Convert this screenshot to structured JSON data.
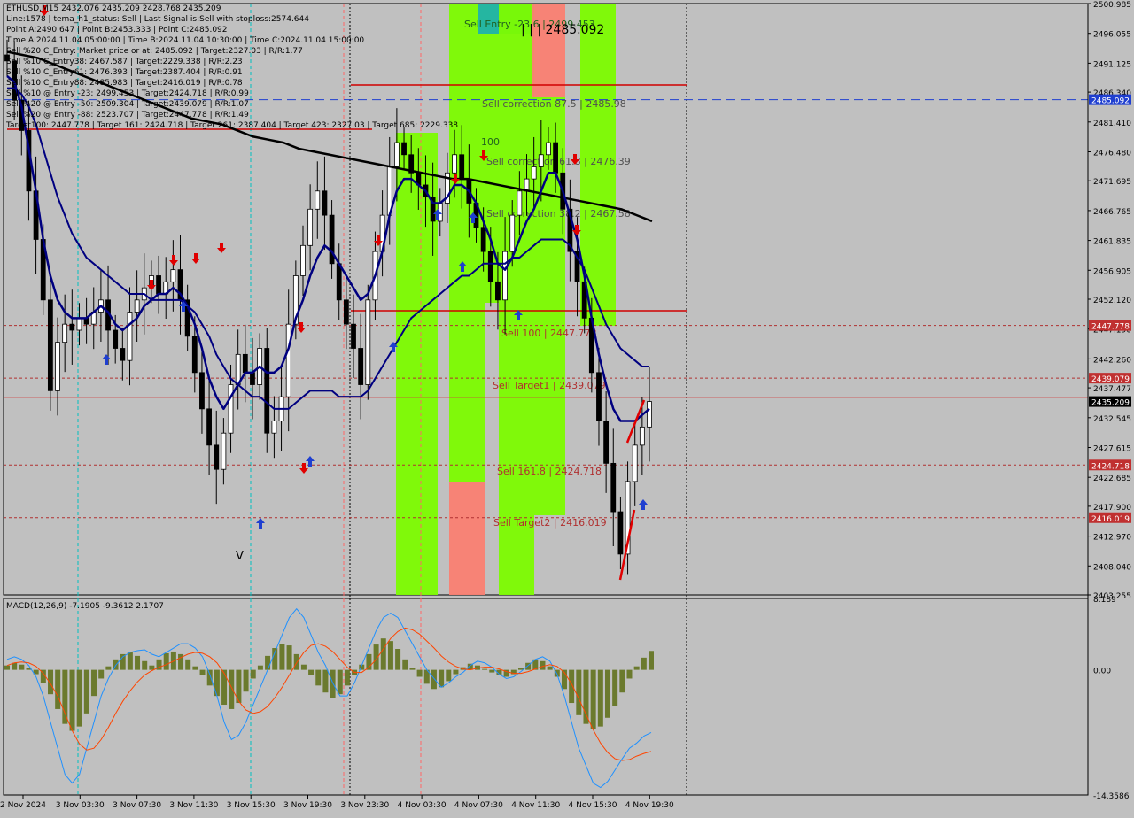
{
  "header": {
    "symbol": "ETHUSD,M15",
    "ohlc": "2432.076 2435.209 2428.768 2435.209",
    "info_lines": [
      "Line:1578 | tema_h1_status: Sell | Last Signal is:Sell with stoploss:2574.644",
      "Point A:2490.647 | Point B:2453.333 | Point C:2485.092",
      "Time A:2024.11.04 05:00:00 | Time B:2024.11.04 10:30:00 | Time C:2024.11.04 15:00:00",
      "Sell %20 C_Entry: Market price or at: 2485.092 | Target:2327.03 | R/R:1.77",
      "Sell %10 C_Entry38: 2467.587 | Target:2229.338 | R/R:2.23",
      "Sell %10 C_Entry61: 2476.393 | Target:2387.404 | R/R:0.91",
      "Sell %10 C_Entry88: 2485.983 | Target:2416.019 | R/R:0.78",
      "Sell %10 @ Entry -23: 2499.453 | Target:2424.718 | R/R:0.99",
      "Sell %20 @ Entry -50: 2509.304 | Target:2439.079 | R/R:1.07",
      "Sell %20 @ Entry -88: 2523.707 | Target:2447.778 | R/R:1.49",
      "Target100: 2447.778 | Target 161: 2424.718 | Target 261: 2387.404 | Target 423: 2327.03 | Target 685: 2229.338"
    ]
  },
  "colors": {
    "background": "#c0c0c0",
    "price_line": "#000080",
    "ma_black": "#000000",
    "green_zone": "#7cfc00",
    "red_zone": "#fa8072",
    "teal_zone": "#20b2aa",
    "level_red": "#d00000",
    "price_tag": "#000000",
    "macd_hist": "#6b7a2e",
    "macd_main": "#1e90ff",
    "macd_signal": "#ff4500"
  },
  "chart_data": [
    {
      "type": "line",
      "symbol": "ETHUSD,M15",
      "y_axis_ticks": [
        2500.985,
        2496.055,
        2491.125,
        2486.34,
        2481.41,
        2476.48,
        2471.695,
        2466.765,
        2461.835,
        2456.905,
        2452.12,
        2447.19,
        2442.26,
        2437.477,
        2432.545,
        2427.615,
        2422.685,
        2417.9,
        2412.97,
        2408.04,
        2403.255
      ],
      "ylim": [
        2403.255,
        2500.985
      ],
      "x_axis_ticks": [
        "2 Nov 2024",
        "3 Nov 03:30",
        "3 Nov 07:30",
        "3 Nov 11:30",
        "3 Nov 15:30",
        "3 Nov 19:30",
        "3 Nov 23:30",
        "4 Nov 03:30",
        "4 Nov 07:30",
        "4 Nov 11:30",
        "4 Nov 15:30",
        "4 Nov 19:30"
      ],
      "price_tags": [
        {
          "label": "2485.092",
          "value": 2485.092,
          "color": "#1f3fd0"
        },
        {
          "label": "2447.778",
          "value": 2447.778,
          "color": "#c03030"
        },
        {
          "label": "2439.079",
          "value": 2439.079,
          "color": "#c03030"
        },
        {
          "label": "2435.209",
          "value": 2435.209,
          "color": "#000000"
        },
        {
          "label": "2424.718",
          "value": 2424.718,
          "color": "#c03030"
        },
        {
          "label": "2416.019",
          "value": 2416.019,
          "color": "#c03030"
        }
      ],
      "level_labels": [
        {
          "text": "Sell Entry -23.6 | 2499.453",
          "value": 2499.453
        },
        {
          "text": "Sell correction 87.5 | 2485.98",
          "value": 2485.98
        },
        {
          "text": "Sell correction 61.8 | 2476.39",
          "value": 2476.39
        },
        {
          "text": "Sell correction 38.2 | 2467.58",
          "value": 2467.58
        },
        {
          "text": "Sell 100 | 2447.778",
          "value": 2447.778
        },
        {
          "text": "Sell Target1 | 2439.079",
          "value": 2439.079
        },
        {
          "text": "Sell 161.8 | 2424.718",
          "value": 2424.718
        },
        {
          "text": "Sell Target2 | 2416.019",
          "value": 2416.019
        }
      ],
      "annotations": [
        "| | | 2485.092",
        "100",
        "V"
      ],
      "series": [
        {
          "name": "close",
          "values": [
            2491.5,
            2485,
            2480,
            2470,
            2462,
            2452,
            2437,
            2445,
            2448,
            2447,
            2449,
            2448,
            2450,
            2452,
            2447,
            2444,
            2442,
            2450,
            2452,
            2454,
            2456,
            2453,
            2455,
            2457,
            2452,
            2446,
            2440,
            2434,
            2428,
            2424,
            2430,
            2438,
            2443,
            2440,
            2438,
            2444,
            2430,
            2432,
            2436,
            2448,
            2456,
            2461,
            2467,
            2470,
            2466,
            2458,
            2452,
            2448,
            2444,
            2438,
            2452,
            2460,
            2466,
            2474,
            2478,
            2476,
            2473,
            2471,
            2469,
            2465,
            2468,
            2473,
            2476,
            2472,
            2468,
            2464,
            2460,
            2455,
            2452,
            2460,
            2466,
            2470,
            2472,
            2474,
            2476,
            2478,
            2473,
            2467,
            2460,
            2455,
            2449,
            2440,
            2432,
            2425,
            2417,
            2410,
            2422,
            2428,
            2431,
            2435.209
          ]
        },
        {
          "name": "ema_fast",
          "values": [
            2489,
            2488,
            2484,
            2477,
            2470,
            2462,
            2456,
            2452,
            2450,
            2449,
            2449,
            2449,
            2450,
            2451,
            2450,
            2448,
            2447,
            2448,
            2449,
            2451,
            2452,
            2453,
            2453,
            2454,
            2453,
            2451,
            2448,
            2444,
            2439,
            2436,
            2434,
            2436,
            2438,
            2440,
            2440,
            2441,
            2440,
            2440,
            2441,
            2444,
            2449,
            2452,
            2456,
            2459,
            2461,
            2460,
            2458,
            2456,
            2454,
            2452,
            2453,
            2456,
            2460,
            2466,
            2470,
            2472,
            2472,
            2471,
            2470,
            2468,
            2468,
            2469,
            2471,
            2471,
            2470,
            2468,
            2465,
            2462,
            2458,
            2457,
            2459,
            2462,
            2465,
            2467,
            2470,
            2473,
            2473,
            2470,
            2466,
            2462,
            2456,
            2449,
            2443,
            2438,
            2434,
            2432,
            2432,
            2432,
            2433,
            2434
          ]
        },
        {
          "name": "ema_slow",
          "values": [
            2487,
            2487,
            2486,
            2484,
            2481,
            2477,
            2473,
            2469,
            2466,
            2463,
            2461,
            2459,
            2458,
            2457,
            2456,
            2455,
            2454,
            2453,
            2453,
            2453,
            2452,
            2452,
            2452,
            2452,
            2452,
            2451,
            2450,
            2448,
            2446,
            2443,
            2441,
            2439,
            2438,
            2437,
            2436,
            2436,
            2435,
            2434,
            2434,
            2434,
            2435,
            2436,
            2437,
            2437,
            2437,
            2437,
            2436,
            2436,
            2436,
            2436,
            2437,
            2439,
            2441,
            2443,
            2445,
            2447,
            2449,
            2450,
            2451,
            2452,
            2453,
            2454,
            2455,
            2456,
            2456,
            2457,
            2458,
            2458,
            2458,
            2458,
            2459,
            2459,
            2460,
            2461,
            2462,
            2462,
            2462,
            2462,
            2461,
            2459,
            2457,
            2454,
            2451,
            2448,
            2446,
            2444,
            2443,
            2442,
            2441,
            2441
          ]
        },
        {
          "name": "ma_black",
          "values": [
            2493,
            2492.5,
            2492,
            2491,
            2490,
            2489,
            2488,
            2487,
            2486,
            2485,
            2484,
            2483,
            2482,
            2481.5,
            2481,
            2480,
            2479,
            2478.5,
            2478,
            2477,
            2476.5,
            2476,
            2475.5,
            2475,
            2474.5,
            2474,
            2473.5,
            2473,
            2472.5,
            2472,
            2472,
            2471.5,
            2471,
            2470.5,
            2470,
            2469.5,
            2469,
            2468.5,
            2468,
            2467.5,
            2467,
            2466,
            2465
          ]
        }
      ]
    },
    {
      "type": "bar",
      "title": "MACD(12,26,9) -7.1905 -9.3612 2.1707",
      "ylim": [
        -14.3586,
        8.189
      ],
      "y_axis_ticks": [
        8.189,
        0.0,
        -14.3586
      ],
      "series": [
        {
          "name": "histogram",
          "values": [
            0.5,
            0.8,
            0.6,
            0.2,
            -0.5,
            -1.5,
            -2.8,
            -4.5,
            -6.2,
            -7,
            -6.5,
            -5,
            -3,
            -1,
            0.4,
            1.2,
            1.8,
            2.0,
            1.6,
            1.0,
            0.5,
            1.2,
            1.9,
            2.1,
            1.8,
            1.2,
            0.4,
            -0.6,
            -1.8,
            -3,
            -4,
            -4.5,
            -3.8,
            -2.5,
            -1,
            0.5,
            1.6,
            2.5,
            3.0,
            2.8,
            1.8,
            0.6,
            -0.6,
            -1.8,
            -2.6,
            -3.2,
            -2.8,
            -1.8,
            -0.6,
            0.6,
            1.8,
            2.9,
            3.6,
            3.3,
            2.4,
            1.2,
            0.2,
            -0.8,
            -1.6,
            -2.2,
            -2.0,
            -1.3,
            -0.5,
            0.3,
            0.7,
            0.5,
            0.1,
            -0.3,
            -0.6,
            -0.8,
            -0.5,
            0.2,
            0.8,
            1.2,
            1.0,
            0.4,
            -0.8,
            -2.2,
            -3.8,
            -5.2,
            -6.2,
            -6.8,
            -6.5,
            -5.5,
            -4.2,
            -2.6,
            -1.0,
            0.4,
            1.4,
            2.1707
          ]
        },
        {
          "name": "macd",
          "values": [
            1.2,
            1.5,
            1.2,
            0.5,
            -0.8,
            -3,
            -6,
            -9,
            -12,
            -13,
            -12,
            -9,
            -6,
            -3,
            -1,
            0.5,
            1.5,
            2,
            2.2,
            2.3,
            1.8,
            1.5,
            2,
            2.5,
            3,
            3,
            2.5,
            1.5,
            -0.5,
            -3,
            -6,
            -8,
            -7.5,
            -6,
            -4,
            -2,
            0,
            2,
            4,
            6,
            7,
            6,
            4,
            2,
            0.5,
            -1.5,
            -3,
            -3,
            -1.5,
            0.5,
            2.5,
            4.5,
            6,
            6.5,
            6,
            4.5,
            3,
            1.5,
            0,
            -1,
            -2,
            -1.5,
            -0.8,
            -0.3,
            0.5,
            1,
            0.8,
            0.3,
            -0.5,
            -1,
            -0.8,
            -0.2,
            0.5,
            1.2,
            1.5,
            1,
            -0.5,
            -3,
            -6,
            -9,
            -11,
            -13,
            -13.5,
            -12.8,
            -11.5,
            -10.2,
            -9,
            -8.4,
            -7.6,
            -7.1905
          ]
        },
        {
          "name": "signal",
          "values": [
            0.5,
            0.8,
            0.9,
            0.8,
            0.4,
            -0.4,
            -1.6,
            -3,
            -5,
            -7,
            -8.5,
            -9.2,
            -9,
            -8,
            -6.6,
            -5,
            -3.6,
            -2.4,
            -1.4,
            -0.6,
            -0.1,
            0.3,
            0.6,
            1.0,
            1.4,
            1.8,
            2.0,
            1.9,
            1.5,
            0.8,
            -0.4,
            -2,
            -3.6,
            -4.6,
            -5,
            -4.8,
            -4.2,
            -3.2,
            -2,
            -0.6,
            0.8,
            2,
            2.8,
            3,
            2.7,
            2.1,
            1.2,
            0.3,
            -0.3,
            -0.3,
            0.3,
            1.2,
            2.4,
            3.6,
            4.4,
            4.8,
            4.6,
            4.1,
            3.3,
            2.5,
            1.6,
            0.9,
            0.4,
            0.1,
            0.0,
            0.2,
            0.3,
            0.3,
            0.1,
            -0.2,
            -0.4,
            -0.4,
            -0.2,
            0.1,
            0.4,
            0.6,
            0.4,
            -0.3,
            -1.6,
            -3.3,
            -5.1,
            -6.9,
            -8.4,
            -9.5,
            -10.2,
            -10.4,
            -10.3,
            -9.9,
            -9.6,
            -9.3612
          ]
        }
      ]
    }
  ]
}
